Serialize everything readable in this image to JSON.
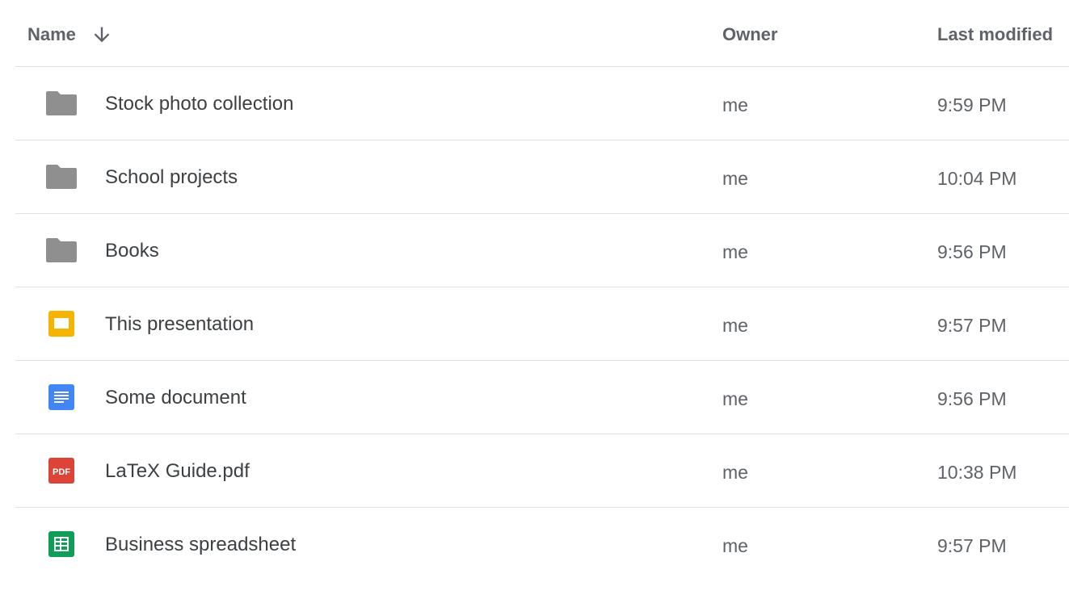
{
  "header": {
    "name_label": "Name",
    "owner_label": "Owner",
    "modified_label": "Last modified",
    "sort_icon": "arrow-down-icon"
  },
  "files": [
    {
      "name": "Stock photo collection",
      "owner": "me",
      "modified": "9:59 PM",
      "type": "folder",
      "icon": "folder-icon",
      "color": "#8f8f8f"
    },
    {
      "name": "School projects",
      "owner": "me",
      "modified": "10:04 PM",
      "type": "folder",
      "icon": "folder-icon",
      "color": "#8f8f8f"
    },
    {
      "name": "Books",
      "owner": "me",
      "modified": "9:56 PM",
      "type": "folder",
      "icon": "folder-icon",
      "color": "#8f8f8f"
    },
    {
      "name": "This presentation",
      "owner": "me",
      "modified": "9:57 PM",
      "type": "slides",
      "icon": "slides-icon",
      "color": "#f4b400"
    },
    {
      "name": "Some document",
      "owner": "me",
      "modified": "9:56 PM",
      "type": "doc",
      "icon": "docs-icon",
      "color": "#4285f4"
    },
    {
      "name": "LaTeX Guide.pdf",
      "owner": "me",
      "modified": "10:38 PM",
      "type": "pdf",
      "icon": "pdf-icon",
      "color": "#db4437",
      "icon_text": "PDF"
    },
    {
      "name": "Business spreadsheet",
      "owner": "me",
      "modified": "9:57 PM",
      "type": "sheet",
      "icon": "sheets-icon",
      "color": "#0f9d58"
    }
  ]
}
